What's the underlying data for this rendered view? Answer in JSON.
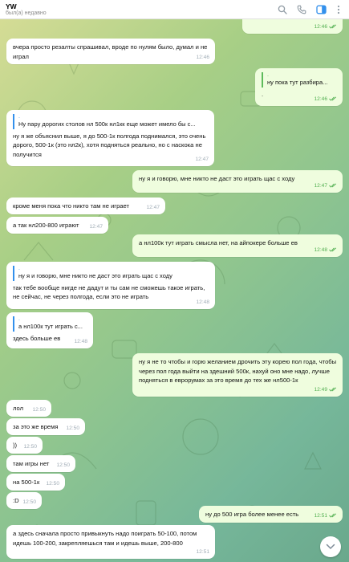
{
  "header": {
    "title": "YW",
    "status": "был(а) недавно",
    "icons": [
      "search-icon",
      "phone-icon",
      "sidebar-icon",
      "more-icon"
    ]
  },
  "colors": {
    "incoming_bubble": "#ffffff",
    "outgoing_bubble": "#effdde",
    "outgoing_meta": "#4fae4e",
    "quote_bar": "#3390ec",
    "sidebar_icon_active": "#3390ec"
  },
  "messages": [
    {
      "dir": "out",
      "text": "",
      "time": "12:46"
    },
    {
      "dir": "in",
      "text": "вчера просто резалты спрашивал, вроде по нулям было, думал и не играл",
      "time": "12:46"
    },
    {
      "dir": "out",
      "quote_name": ".",
      "quote": "ну пока тут разбира...",
      "text": ".",
      "time": "12:46"
    },
    {
      "dir": "in",
      "quote_name": ".",
      "quote": "Ну пару дорогих столов нл 500к нл1кк еще может имело бы с...",
      "text": "ну я же объяснил выше, я до 500-1к полгода поднимался, это очень дорого, 500-1к (это нл2к), хотя подняться реально, но с наскока не получится",
      "time": "12:47"
    },
    {
      "dir": "out",
      "text": "ну я и говорю, мне никто не даст это играть щас с ходу",
      "time": "12:47"
    },
    {
      "dir": "in",
      "text": "кроме меня пока что никто там не играет",
      "time": "12:47"
    },
    {
      "dir": "in",
      "text": "а так нл200-800 играют",
      "time": "12:47"
    },
    {
      "dir": "out",
      "text": "а нл100к тут играть смысла нет, на айпокере больше ев",
      "time": "12:48"
    },
    {
      "dir": "in",
      "quote_name": ".",
      "quote": "ну я и говорю, мне никто не даст это играть щас с ходу",
      "text": "так тебе вообще нигде не дадут и ты сам не сможешь такое играть, не сейчас, не через полгода, если это не играть",
      "time": "12:48"
    },
    {
      "dir": "in",
      "quote_name": ".",
      "quote": "а нл100к тут играть с...",
      "text": "здесь больше ев",
      "time": "12:48"
    },
    {
      "dir": "out",
      "text": "ну я не то чтобы и горю желанием дрочить эту корею пол года, чтобы через пол года выйти на здешний 500к, нахуй оно мне надо, лучше подняться в еврорумах за это время до тех же нл500-1к",
      "time": "12:49"
    },
    {
      "dir": "in",
      "text": "лол",
      "time": "12:50"
    },
    {
      "dir": "in",
      "text": "за это же время",
      "time": "12:50"
    },
    {
      "dir": "in",
      "text": "))",
      "time": "12:50"
    },
    {
      "dir": "in",
      "text": "там игры нет",
      "time": "12:50"
    },
    {
      "dir": "in",
      "text": "на 500-1к",
      "time": "12:50"
    },
    {
      "dir": "in",
      "text": ":D",
      "time": "12:50"
    },
    {
      "dir": "out",
      "text": "ну до 500 игра более менее есть",
      "time": "12:51"
    },
    {
      "dir": "in",
      "text": "а здесь сначала просто привыкнуть надо поиграть 50-100, потом идешь 100-200, закрепляешься там и идешь выше, 200-800",
      "time": "12:51"
    }
  ]
}
